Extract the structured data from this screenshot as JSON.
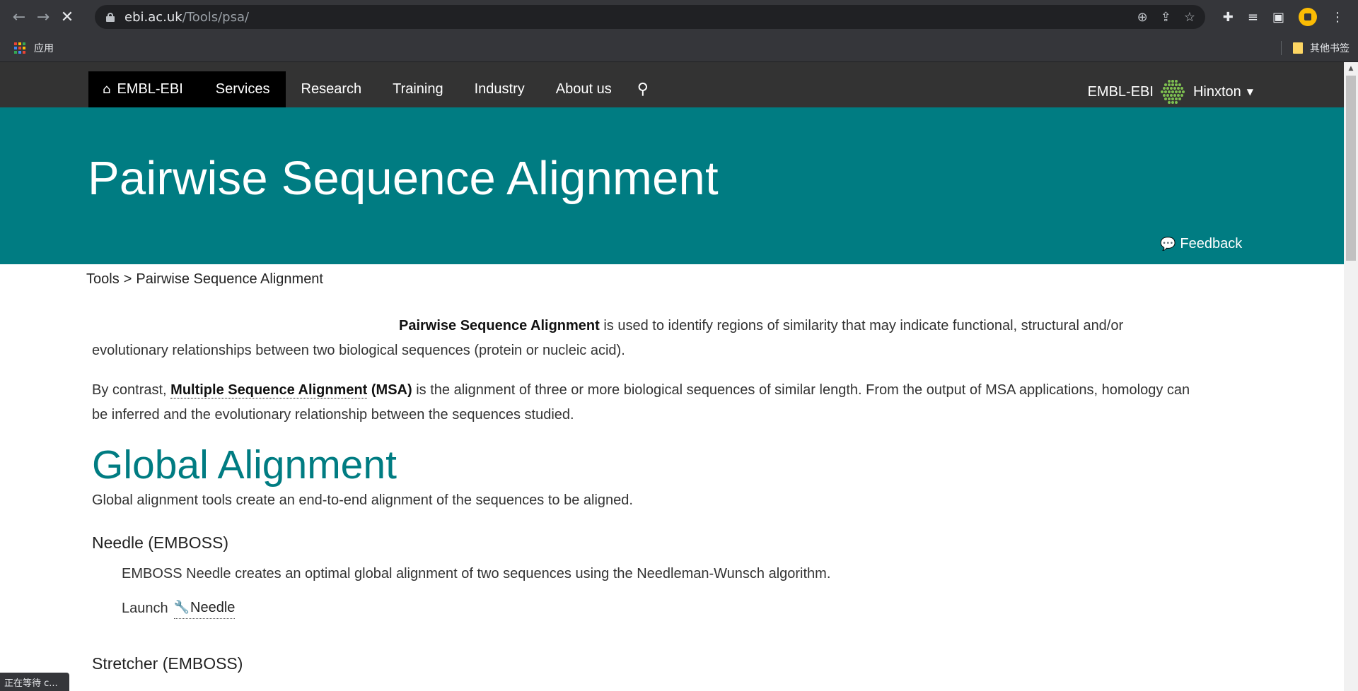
{
  "browser": {
    "back_icon": "←",
    "forward_icon": "→",
    "stop_icon": "✕",
    "url_domain": "ebi.ac.uk",
    "url_path": "/Tools/psa/",
    "zoom_icon": "⊕",
    "share_icon": "⇪",
    "star_icon": "☆",
    "extensions_icon": "✚",
    "media_icon": "≡",
    "sidepanel_icon": "▣",
    "menu_icon": "⋮",
    "apps_label": "应用",
    "bookmarks_folder_label": "其他书签",
    "status_text": "正在等待 c...",
    "apps_colors": [
      "#ea4335",
      "#fbbc04",
      "#34a853",
      "#4285f4",
      "#ea4335",
      "#fbbc04",
      "#34a853",
      "#4285f4",
      "#ea4335"
    ]
  },
  "site_nav": {
    "home_icon": "⌂",
    "home_label": "EMBL-EBI",
    "items": [
      "Services",
      "Research",
      "Training",
      "Industry",
      "About us"
    ],
    "search_icon": "⚲",
    "right_label": "EMBL-EBI",
    "location_label": "Hinxton",
    "caret": "▼",
    "colors": {
      "bar": "#333333",
      "active": "#000000"
    }
  },
  "hero": {
    "title": "Pairwise Sequence Alignment",
    "feedback_icon": "💬",
    "feedback_label": "Feedback",
    "color": "#007c82"
  },
  "breadcrumb": {
    "root": "Tools",
    "separator": ">",
    "current": "Pairwise Sequence Alignment"
  },
  "content": {
    "intro_bold": "Pairwise Sequence Alignment",
    "intro_rest": " is used to identify regions of similarity that may indicate functional, structural and/or evolutionary relationships between two biological sequences (protein or nucleic acid).",
    "para2_prefix": "By contrast, ",
    "para2_link": "Multiple Sequence Alignment",
    "para2_abbr": " (MSA)",
    "para2_rest": " is the alignment of three or more biological sequences of similar length. From the output of MSA applications, homology can be inferred and the evolutionary relationship between the sequences studied.",
    "global_heading": "Global Alignment",
    "global_desc": "Global alignment tools create an end-to-end alignment of the sequences to be aligned.",
    "needle_heading": "Needle (EMBOSS)",
    "needle_desc": "EMBOSS Needle creates an optimal global alignment of two sequences using the Needleman-Wunsch algorithm.",
    "launch_label": "Launch",
    "wrench_icon": "🔧",
    "needle_link": "Needle",
    "stretcher_heading": "Stretcher (EMBOSS)"
  }
}
